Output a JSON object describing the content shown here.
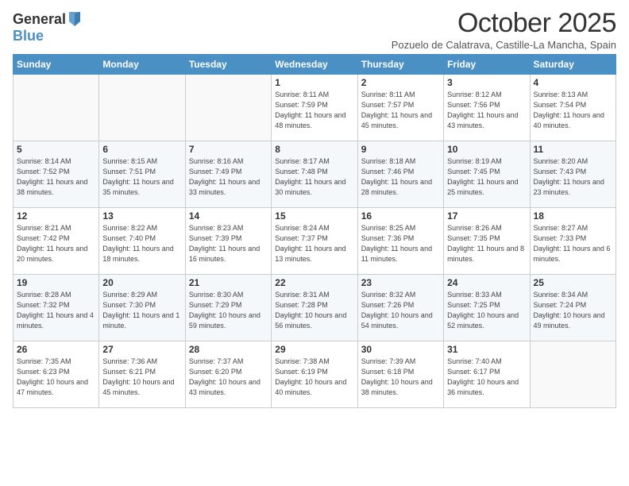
{
  "logo": {
    "general": "General",
    "blue": "Blue"
  },
  "title": "October 2025",
  "subtitle": "Pozuelo de Calatrava, Castille-La Mancha, Spain",
  "days_header": [
    "Sunday",
    "Monday",
    "Tuesday",
    "Wednesday",
    "Thursday",
    "Friday",
    "Saturday"
  ],
  "weeks": [
    [
      {
        "day": "",
        "info": ""
      },
      {
        "day": "",
        "info": ""
      },
      {
        "day": "",
        "info": ""
      },
      {
        "day": "1",
        "info": "Sunrise: 8:11 AM\nSunset: 7:59 PM\nDaylight: 11 hours and 48 minutes."
      },
      {
        "day": "2",
        "info": "Sunrise: 8:11 AM\nSunset: 7:57 PM\nDaylight: 11 hours and 45 minutes."
      },
      {
        "day": "3",
        "info": "Sunrise: 8:12 AM\nSunset: 7:56 PM\nDaylight: 11 hours and 43 minutes."
      },
      {
        "day": "4",
        "info": "Sunrise: 8:13 AM\nSunset: 7:54 PM\nDaylight: 11 hours and 40 minutes."
      }
    ],
    [
      {
        "day": "5",
        "info": "Sunrise: 8:14 AM\nSunset: 7:52 PM\nDaylight: 11 hours and 38 minutes."
      },
      {
        "day": "6",
        "info": "Sunrise: 8:15 AM\nSunset: 7:51 PM\nDaylight: 11 hours and 35 minutes."
      },
      {
        "day": "7",
        "info": "Sunrise: 8:16 AM\nSunset: 7:49 PM\nDaylight: 11 hours and 33 minutes."
      },
      {
        "day": "8",
        "info": "Sunrise: 8:17 AM\nSunset: 7:48 PM\nDaylight: 11 hours and 30 minutes."
      },
      {
        "day": "9",
        "info": "Sunrise: 8:18 AM\nSunset: 7:46 PM\nDaylight: 11 hours and 28 minutes."
      },
      {
        "day": "10",
        "info": "Sunrise: 8:19 AM\nSunset: 7:45 PM\nDaylight: 11 hours and 25 minutes."
      },
      {
        "day": "11",
        "info": "Sunrise: 8:20 AM\nSunset: 7:43 PM\nDaylight: 11 hours and 23 minutes."
      }
    ],
    [
      {
        "day": "12",
        "info": "Sunrise: 8:21 AM\nSunset: 7:42 PM\nDaylight: 11 hours and 20 minutes."
      },
      {
        "day": "13",
        "info": "Sunrise: 8:22 AM\nSunset: 7:40 PM\nDaylight: 11 hours and 18 minutes."
      },
      {
        "day": "14",
        "info": "Sunrise: 8:23 AM\nSunset: 7:39 PM\nDaylight: 11 hours and 16 minutes."
      },
      {
        "day": "15",
        "info": "Sunrise: 8:24 AM\nSunset: 7:37 PM\nDaylight: 11 hours and 13 minutes."
      },
      {
        "day": "16",
        "info": "Sunrise: 8:25 AM\nSunset: 7:36 PM\nDaylight: 11 hours and 11 minutes."
      },
      {
        "day": "17",
        "info": "Sunrise: 8:26 AM\nSunset: 7:35 PM\nDaylight: 11 hours and 8 minutes."
      },
      {
        "day": "18",
        "info": "Sunrise: 8:27 AM\nSunset: 7:33 PM\nDaylight: 11 hours and 6 minutes."
      }
    ],
    [
      {
        "day": "19",
        "info": "Sunrise: 8:28 AM\nSunset: 7:32 PM\nDaylight: 11 hours and 4 minutes."
      },
      {
        "day": "20",
        "info": "Sunrise: 8:29 AM\nSunset: 7:30 PM\nDaylight: 11 hours and 1 minute."
      },
      {
        "day": "21",
        "info": "Sunrise: 8:30 AM\nSunset: 7:29 PM\nDaylight: 10 hours and 59 minutes."
      },
      {
        "day": "22",
        "info": "Sunrise: 8:31 AM\nSunset: 7:28 PM\nDaylight: 10 hours and 56 minutes."
      },
      {
        "day": "23",
        "info": "Sunrise: 8:32 AM\nSunset: 7:26 PM\nDaylight: 10 hours and 54 minutes."
      },
      {
        "day": "24",
        "info": "Sunrise: 8:33 AM\nSunset: 7:25 PM\nDaylight: 10 hours and 52 minutes."
      },
      {
        "day": "25",
        "info": "Sunrise: 8:34 AM\nSunset: 7:24 PM\nDaylight: 10 hours and 49 minutes."
      }
    ],
    [
      {
        "day": "26",
        "info": "Sunrise: 7:35 AM\nSunset: 6:23 PM\nDaylight: 10 hours and 47 minutes."
      },
      {
        "day": "27",
        "info": "Sunrise: 7:36 AM\nSunset: 6:21 PM\nDaylight: 10 hours and 45 minutes."
      },
      {
        "day": "28",
        "info": "Sunrise: 7:37 AM\nSunset: 6:20 PM\nDaylight: 10 hours and 43 minutes."
      },
      {
        "day": "29",
        "info": "Sunrise: 7:38 AM\nSunset: 6:19 PM\nDaylight: 10 hours and 40 minutes."
      },
      {
        "day": "30",
        "info": "Sunrise: 7:39 AM\nSunset: 6:18 PM\nDaylight: 10 hours and 38 minutes."
      },
      {
        "day": "31",
        "info": "Sunrise: 7:40 AM\nSunset: 6:17 PM\nDaylight: 10 hours and 36 minutes."
      },
      {
        "day": "",
        "info": ""
      }
    ]
  ]
}
